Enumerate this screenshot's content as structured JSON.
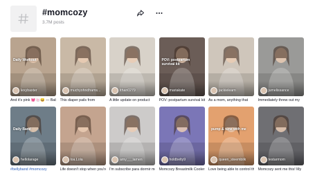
{
  "header": {
    "icon": "hashtag-icon",
    "title": "#momcozy",
    "posts": "3.7M posts",
    "share_icon": "share-icon",
    "more_icon": "more-icon"
  },
  "videos": [
    {
      "user": "lexybaxter",
      "caption": "And it's pink 💓🍥😄 — Baby",
      "overlay": "Daily Workout",
      "bg": "#b9a48f"
    },
    {
      "user": "muchyohndhams...",
      "caption": "This diaper pails from",
      "overlay": "",
      "bg": "#c9b9a6"
    },
    {
      "user": "ithan0279",
      "caption": "A little update on product",
      "overlay": "",
      "bg": "#d8d2c9"
    },
    {
      "user": "mariakate",
      "caption": "POV: postpartum survival kit",
      "overlay": "POV: postpartum survival kit",
      "bg": "#6b5d57"
    },
    {
      "user": "jackielearn",
      "caption": "As a mom, anything that",
      "overlay": "",
      "bg": "#cfc6bb"
    },
    {
      "user": "jumelissance",
      "caption": "Immediately threw out my",
      "overlay": "",
      "bg": "#9a9a98"
    },
    {
      "user": "hellolarage",
      "caption": "#bellyband #momcozy",
      "overlay": "Daily Band",
      "bg": "#6e7d88"
    },
    {
      "user": "loa.Lola",
      "caption": "Life doesn't stop when you're",
      "overlay": "",
      "bg": "#c4a48f"
    },
    {
      "user": "amy___lamen",
      "caption": "I'm subscribe para dormir mejor",
      "overlay": "",
      "bg": "#cdcbca"
    },
    {
      "user": "holdbelty9",
      "caption": "Momcozy Breastmilk Cooler -",
      "overlay": "",
      "bg": "#7b76b7"
    },
    {
      "user": "queen_steembilk",
      "caption": "Love being able to control the",
      "overlay": "pump & tune with me",
      "bg": "#e3a16f"
    },
    {
      "user": "testarmom",
      "caption": "Momcozy sent me this! My",
      "overlay": "",
      "bg": "#6f6f73"
    }
  ]
}
